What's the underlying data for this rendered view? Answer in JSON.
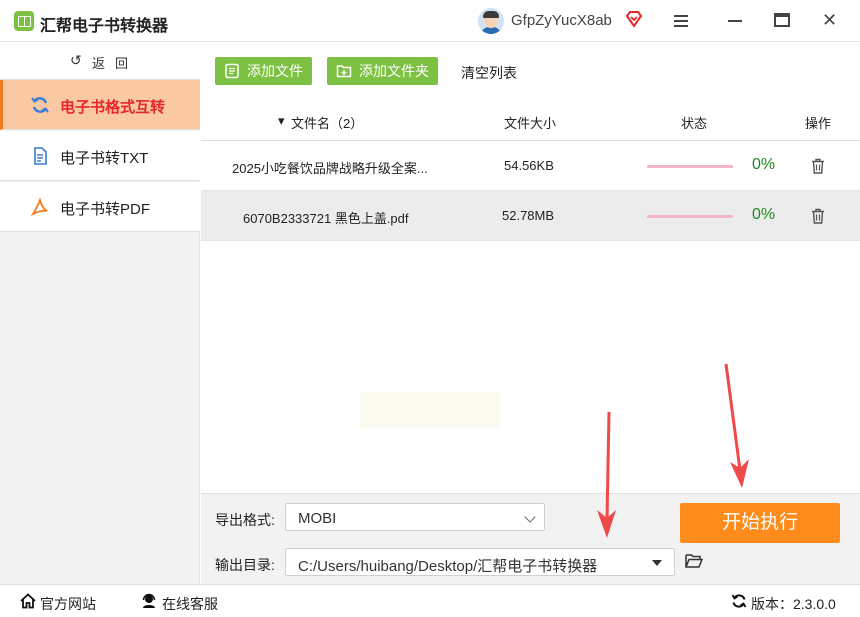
{
  "app": {
    "title": "汇帮电子书转换器",
    "username": "GfpZyYucX8ab"
  },
  "sidebar": {
    "back_label": "返回",
    "items": [
      {
        "label": "电子书格式互转",
        "active": true,
        "icon": "refresh-icon"
      },
      {
        "label": "电子书转TXT",
        "active": false,
        "icon": "txt-file-icon"
      },
      {
        "label": "电子书转PDF",
        "active": false,
        "icon": "pdf-icon"
      }
    ]
  },
  "toolbar": {
    "add_file": "添加文件",
    "add_folder": "添加文件夹",
    "clear_list": "清空列表"
  },
  "table": {
    "headers": {
      "name": "文件名（2）",
      "size": "文件大小",
      "status": "状态",
      "action": "操作"
    },
    "rows": [
      {
        "name": "2025小吃餐饮品牌战略升级全案...",
        "size": "54.56KB",
        "progress": 0,
        "percent": "0%"
      },
      {
        "name": "6070B2333721 黑色上盖.pdf",
        "size": "52.78MB",
        "progress": 0,
        "percent": "0%"
      }
    ]
  },
  "config": {
    "format_label": "导出格式:",
    "format_value": "MOBI",
    "dir_label": "输出目录:",
    "dir_value": "C:/Users/huibang/Desktop/汇帮电子书转换器",
    "start_label": "开始执行"
  },
  "statusbar": {
    "website": "官方网站",
    "support": "在线客服",
    "version": "版本：2.3.0.0"
  },
  "colors": {
    "green": "#7cc142",
    "orange": "#ff8c1a",
    "active_bg": "#f8c9a3",
    "active_text": "#e8262a",
    "percent": "#1e8a1e",
    "arrow": "#ef4a4a"
  }
}
